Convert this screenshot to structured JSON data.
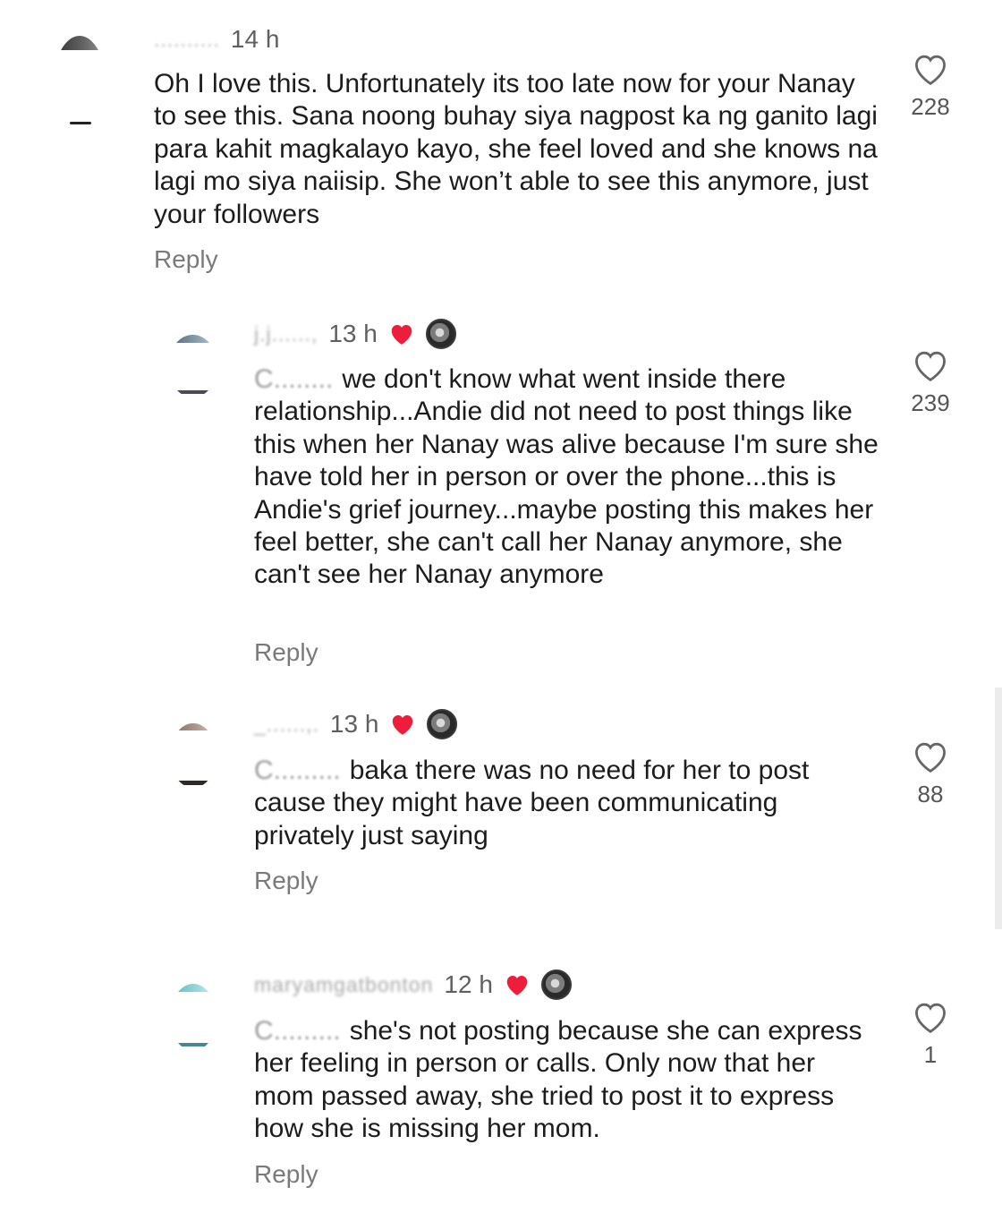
{
  "comments": [
    {
      "username": "..........",
      "time": "14 h",
      "text": "Oh I love this. Unfortunately its too late now for your Nanay to see this. Sana noong buhay siya nagpost ka ng ganito lagi para kahit magkalayo kayo, she feel loved and she knows na lagi mo siya naiisip. She won’t able to see this anymore, just your followers",
      "reply": "Reply",
      "likes": "228"
    },
    {
      "username": "j.j......,",
      "time": "13 h",
      "mention": "C........",
      "text": "we don't know what went inside there relationship...Andie did not need to post things like this when her Nanay was alive because I'm sure she have told her in person or over the phone...this is Andie's grief journey...maybe posting this makes her feel better, she can't call her Nanay anymore, she can't see her Nanay anymore",
      "reply": "Reply",
      "likes": "239"
    },
    {
      "username": "_......,.",
      "time": "13 h",
      "mention": "C.........",
      "text": "baka there was no need for her to post cause they might have been communicating privately just saying",
      "reply": "Reply",
      "likes": "88"
    },
    {
      "username": "maryamgatbonton",
      "time": "12 h",
      "mention": "C.........",
      "text": "she's not posting because she can express her feeling in person or calls. Only now that her mom passed away, she tried to post it to express how she is missing her mom.",
      "reply": "Reply",
      "likes": "1"
    }
  ],
  "colors": {
    "creator_heart": "#ee1d3c",
    "text": "#1c1c1c",
    "muted": "#7a7a7a"
  },
  "icons": {
    "like": "heart-outline-icon",
    "creator_liked": "heart-filled-icon"
  }
}
